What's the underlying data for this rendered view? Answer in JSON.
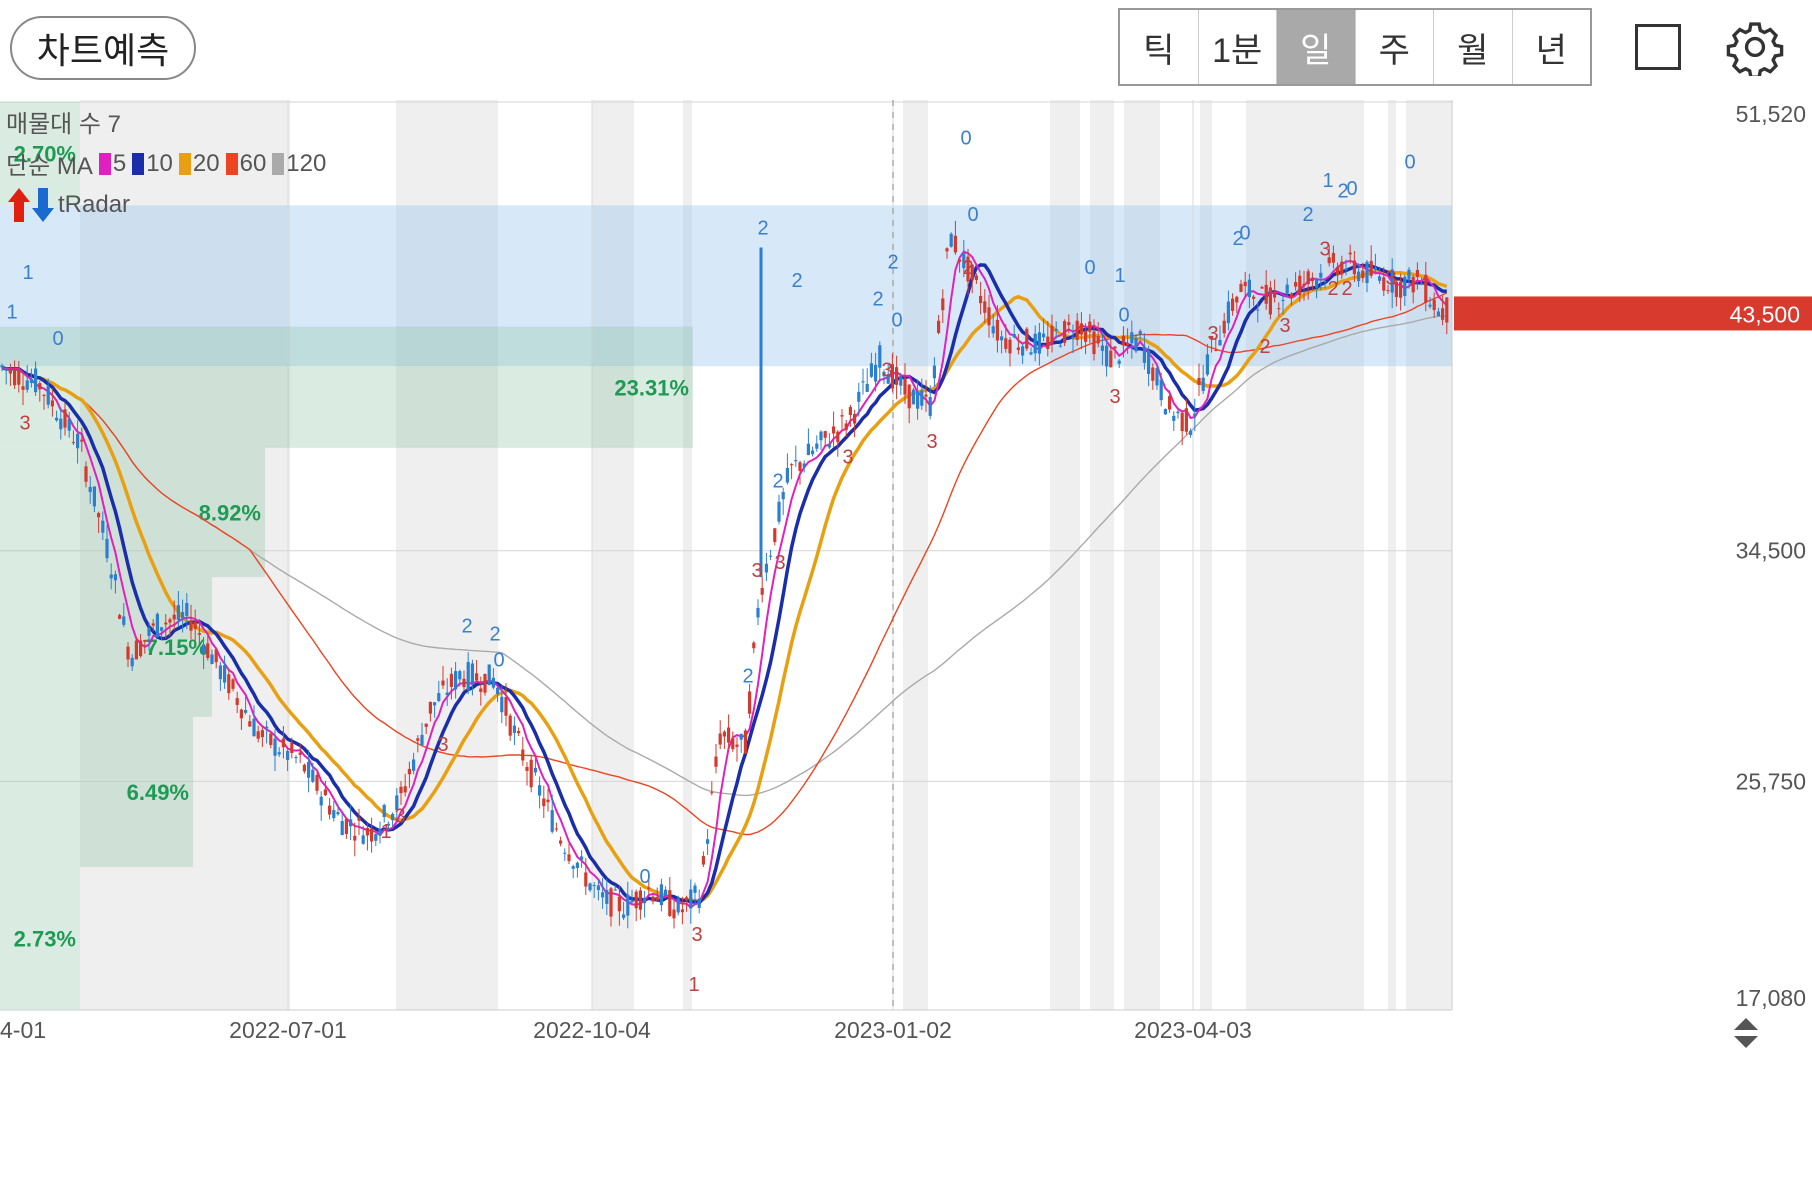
{
  "toolbar": {
    "predict_label": "차트예측",
    "periods": [
      "틱",
      "1분",
      "일",
      "주",
      "월",
      "년"
    ],
    "active_period": "일"
  },
  "icons": {
    "layout": "square-icon",
    "settings": "gear-icon"
  },
  "overlay": {
    "volume_profile_label": "매물대 수 7",
    "ma_label": "단순 MA",
    "ma_periods": [
      {
        "period": "5",
        "color": "#e020c0"
      },
      {
        "period": "10",
        "color": "#1a2eaa"
      },
      {
        "period": "20",
        "color": "#e8a012"
      },
      {
        "period": "60",
        "color": "#ee4422"
      },
      {
        "period": "120",
        "color": "#aaaaaa"
      }
    ],
    "radar_label": "tRadar"
  },
  "chart_data": {
    "type": "candlestick",
    "y_ticks": [
      "51,520",
      "34,500",
      "25,750",
      "17,080"
    ],
    "x_ticks": [
      "4-01",
      "2022-07-01",
      "2022-10-04",
      "2023-01-02",
      "2023-04-03"
    ],
    "current_price_label": "43,500",
    "current_price": 43500,
    "ylim": [
      17080,
      51520
    ],
    "highlight_band": [
      41500,
      47600
    ],
    "volume_profile": [
      {
        "label": "2.70%",
        "low": 47600,
        "high": 51520
      },
      {
        "label": "23.31%",
        "low": 38400,
        "high": 43000
      },
      {
        "label": "8.92%",
        "low": 33500,
        "high": 38400
      },
      {
        "label": "7.15%",
        "low": 28200,
        "high": 33500
      },
      {
        "label": "6.49%",
        "low": 22500,
        "high": 28200
      },
      {
        "label": "2.73%",
        "low": 17080,
        "high": 22500
      }
    ],
    "markers": [
      {
        "text": "1",
        "x": 12,
        "y": 43300,
        "c": "#3a80cc"
      },
      {
        "text": "1",
        "x": 28,
        "y": 44800,
        "c": "#3a80cc"
      },
      {
        "text": "0",
        "x": 58,
        "y": 42300,
        "c": "#3a80cc"
      },
      {
        "text": "3",
        "x": 25,
        "y": 39100,
        "c": "#c04040"
      },
      {
        "text": "2",
        "x": 763,
        "y": 46500,
        "c": "#3a80cc"
      },
      {
        "text": "2",
        "x": 797,
        "y": 44500,
        "c": "#3a80cc"
      },
      {
        "text": "2",
        "x": 778,
        "y": 36900,
        "c": "#3a80cc"
      },
      {
        "text": "3",
        "x": 757,
        "y": 33500,
        "c": "#c04040"
      },
      {
        "text": "3",
        "x": 780,
        "y": 33800,
        "c": "#c04040"
      },
      {
        "text": "2",
        "x": 467,
        "y": 31400,
        "c": "#3a80cc"
      },
      {
        "text": "2",
        "x": 495,
        "y": 31100,
        "c": "#3a80cc"
      },
      {
        "text": "0",
        "x": 499,
        "y": 30100,
        "c": "#3a80cc"
      },
      {
        "text": "3",
        "x": 443,
        "y": 26900,
        "c": "#c04040"
      },
      {
        "text": "3",
        "x": 400,
        "y": 24200,
        "c": "#c04040"
      },
      {
        "text": "1",
        "x": 386,
        "y": 23600,
        "c": "#c04040"
      },
      {
        "text": "0",
        "x": 645,
        "y": 21900,
        "c": "#3a80cc"
      },
      {
        "text": "2",
        "x": 748,
        "y": 29500,
        "c": "#3a80cc"
      },
      {
        "text": "3",
        "x": 697,
        "y": 19700,
        "c": "#c04040"
      },
      {
        "text": "1",
        "x": 694,
        "y": 17800,
        "c": "#c04040"
      },
      {
        "text": "2",
        "x": 893,
        "y": 45200,
        "c": "#3a80cc"
      },
      {
        "text": "2",
        "x": 878,
        "y": 43800,
        "c": "#3a80cc"
      },
      {
        "text": "0",
        "x": 897,
        "y": 43000,
        "c": "#3a80cc"
      },
      {
        "text": "3",
        "x": 887,
        "y": 41100,
        "c": "#c04040"
      },
      {
        "text": "3",
        "x": 848,
        "y": 37800,
        "c": "#c04040"
      },
      {
        "text": "3",
        "x": 932,
        "y": 38400,
        "c": "#c04040"
      },
      {
        "text": "0",
        "x": 966,
        "y": 49900,
        "c": "#3a80cc"
      },
      {
        "text": "0",
        "x": 973,
        "y": 47000,
        "c": "#3a80cc"
      },
      {
        "text": "2",
        "x": 968,
        "y": 45000,
        "c": "#c04040"
      },
      {
        "text": "0",
        "x": 1090,
        "y": 45000,
        "c": "#3a80cc"
      },
      {
        "text": "1",
        "x": 1120,
        "y": 44700,
        "c": "#3a80cc"
      },
      {
        "text": "0",
        "x": 1124,
        "y": 43200,
        "c": "#3a80cc"
      },
      {
        "text": "3",
        "x": 1115,
        "y": 40100,
        "c": "#c04040"
      },
      {
        "text": "0",
        "x": 1245,
        "y": 46300,
        "c": "#3a80cc"
      },
      {
        "text": "2",
        "x": 1238,
        "y": 46100,
        "c": "#3a80cc"
      },
      {
        "text": "2",
        "x": 1308,
        "y": 47000,
        "c": "#3a80cc"
      },
      {
        "text": "1",
        "x": 1328,
        "y": 48300,
        "c": "#3a80cc"
      },
      {
        "text": "2",
        "x": 1343,
        "y": 47900,
        "c": "#3a80cc"
      },
      {
        "text": "0",
        "x": 1352,
        "y": 48000,
        "c": "#3a80cc"
      },
      {
        "text": "0",
        "x": 1410,
        "y": 49000,
        "c": "#3a80cc"
      },
      {
        "text": "3",
        "x": 1213,
        "y": 42500,
        "c": "#c04040"
      },
      {
        "text": "3",
        "x": 1325,
        "y": 45700,
        "c": "#c04040"
      },
      {
        "text": "2",
        "x": 1333,
        "y": 44200,
        "c": "#c04040"
      },
      {
        "text": "2",
        "x": 1347,
        "y": 44200,
        "c": "#c04040"
      },
      {
        "text": "3",
        "x": 1391,
        "y": 44600,
        "c": "#c04040"
      },
      {
        "text": "2",
        "x": 1265,
        "y": 42000,
        "c": "#c04040"
      },
      {
        "text": "3",
        "x": 1285,
        "y": 42800,
        "c": "#c04040"
      }
    ]
  }
}
